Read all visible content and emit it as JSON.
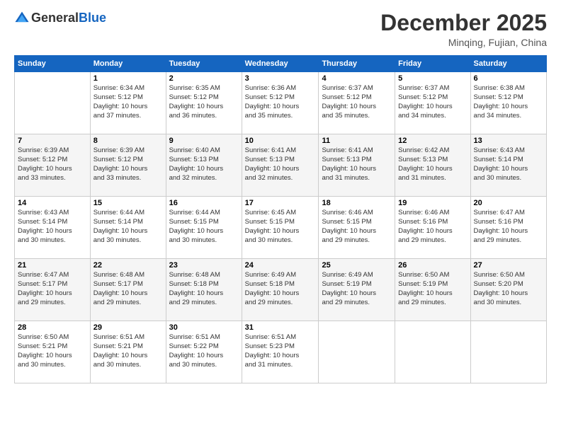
{
  "header": {
    "logo_line1": "General",
    "logo_line2": "Blue",
    "month": "December 2025",
    "location": "Minqing, Fujian, China"
  },
  "days_of_week": [
    "Sunday",
    "Monday",
    "Tuesday",
    "Wednesday",
    "Thursday",
    "Friday",
    "Saturday"
  ],
  "weeks": [
    [
      {
        "num": "",
        "info": ""
      },
      {
        "num": "1",
        "info": "Sunrise: 6:34 AM\nSunset: 5:12 PM\nDaylight: 10 hours\nand 37 minutes."
      },
      {
        "num": "2",
        "info": "Sunrise: 6:35 AM\nSunset: 5:12 PM\nDaylight: 10 hours\nand 36 minutes."
      },
      {
        "num": "3",
        "info": "Sunrise: 6:36 AM\nSunset: 5:12 PM\nDaylight: 10 hours\nand 35 minutes."
      },
      {
        "num": "4",
        "info": "Sunrise: 6:37 AM\nSunset: 5:12 PM\nDaylight: 10 hours\nand 35 minutes."
      },
      {
        "num": "5",
        "info": "Sunrise: 6:37 AM\nSunset: 5:12 PM\nDaylight: 10 hours\nand 34 minutes."
      },
      {
        "num": "6",
        "info": "Sunrise: 6:38 AM\nSunset: 5:12 PM\nDaylight: 10 hours\nand 34 minutes."
      }
    ],
    [
      {
        "num": "7",
        "info": "Sunrise: 6:39 AM\nSunset: 5:12 PM\nDaylight: 10 hours\nand 33 minutes."
      },
      {
        "num": "8",
        "info": "Sunrise: 6:39 AM\nSunset: 5:12 PM\nDaylight: 10 hours\nand 33 minutes."
      },
      {
        "num": "9",
        "info": "Sunrise: 6:40 AM\nSunset: 5:13 PM\nDaylight: 10 hours\nand 32 minutes."
      },
      {
        "num": "10",
        "info": "Sunrise: 6:41 AM\nSunset: 5:13 PM\nDaylight: 10 hours\nand 32 minutes."
      },
      {
        "num": "11",
        "info": "Sunrise: 6:41 AM\nSunset: 5:13 PM\nDaylight: 10 hours\nand 31 minutes."
      },
      {
        "num": "12",
        "info": "Sunrise: 6:42 AM\nSunset: 5:13 PM\nDaylight: 10 hours\nand 31 minutes."
      },
      {
        "num": "13",
        "info": "Sunrise: 6:43 AM\nSunset: 5:14 PM\nDaylight: 10 hours\nand 30 minutes."
      }
    ],
    [
      {
        "num": "14",
        "info": "Sunrise: 6:43 AM\nSunset: 5:14 PM\nDaylight: 10 hours\nand 30 minutes."
      },
      {
        "num": "15",
        "info": "Sunrise: 6:44 AM\nSunset: 5:14 PM\nDaylight: 10 hours\nand 30 minutes."
      },
      {
        "num": "16",
        "info": "Sunrise: 6:44 AM\nSunset: 5:15 PM\nDaylight: 10 hours\nand 30 minutes."
      },
      {
        "num": "17",
        "info": "Sunrise: 6:45 AM\nSunset: 5:15 PM\nDaylight: 10 hours\nand 30 minutes."
      },
      {
        "num": "18",
        "info": "Sunrise: 6:46 AM\nSunset: 5:15 PM\nDaylight: 10 hours\nand 29 minutes."
      },
      {
        "num": "19",
        "info": "Sunrise: 6:46 AM\nSunset: 5:16 PM\nDaylight: 10 hours\nand 29 minutes."
      },
      {
        "num": "20",
        "info": "Sunrise: 6:47 AM\nSunset: 5:16 PM\nDaylight: 10 hours\nand 29 minutes."
      }
    ],
    [
      {
        "num": "21",
        "info": "Sunrise: 6:47 AM\nSunset: 5:17 PM\nDaylight: 10 hours\nand 29 minutes."
      },
      {
        "num": "22",
        "info": "Sunrise: 6:48 AM\nSunset: 5:17 PM\nDaylight: 10 hours\nand 29 minutes."
      },
      {
        "num": "23",
        "info": "Sunrise: 6:48 AM\nSunset: 5:18 PM\nDaylight: 10 hours\nand 29 minutes."
      },
      {
        "num": "24",
        "info": "Sunrise: 6:49 AM\nSunset: 5:18 PM\nDaylight: 10 hours\nand 29 minutes."
      },
      {
        "num": "25",
        "info": "Sunrise: 6:49 AM\nSunset: 5:19 PM\nDaylight: 10 hours\nand 29 minutes."
      },
      {
        "num": "26",
        "info": "Sunrise: 6:50 AM\nSunset: 5:19 PM\nDaylight: 10 hours\nand 29 minutes."
      },
      {
        "num": "27",
        "info": "Sunrise: 6:50 AM\nSunset: 5:20 PM\nDaylight: 10 hours\nand 30 minutes."
      }
    ],
    [
      {
        "num": "28",
        "info": "Sunrise: 6:50 AM\nSunset: 5:21 PM\nDaylight: 10 hours\nand 30 minutes."
      },
      {
        "num": "29",
        "info": "Sunrise: 6:51 AM\nSunset: 5:21 PM\nDaylight: 10 hours\nand 30 minutes."
      },
      {
        "num": "30",
        "info": "Sunrise: 6:51 AM\nSunset: 5:22 PM\nDaylight: 10 hours\nand 30 minutes."
      },
      {
        "num": "31",
        "info": "Sunrise: 6:51 AM\nSunset: 5:23 PM\nDaylight: 10 hours\nand 31 minutes."
      },
      {
        "num": "",
        "info": ""
      },
      {
        "num": "",
        "info": ""
      },
      {
        "num": "",
        "info": ""
      }
    ]
  ]
}
